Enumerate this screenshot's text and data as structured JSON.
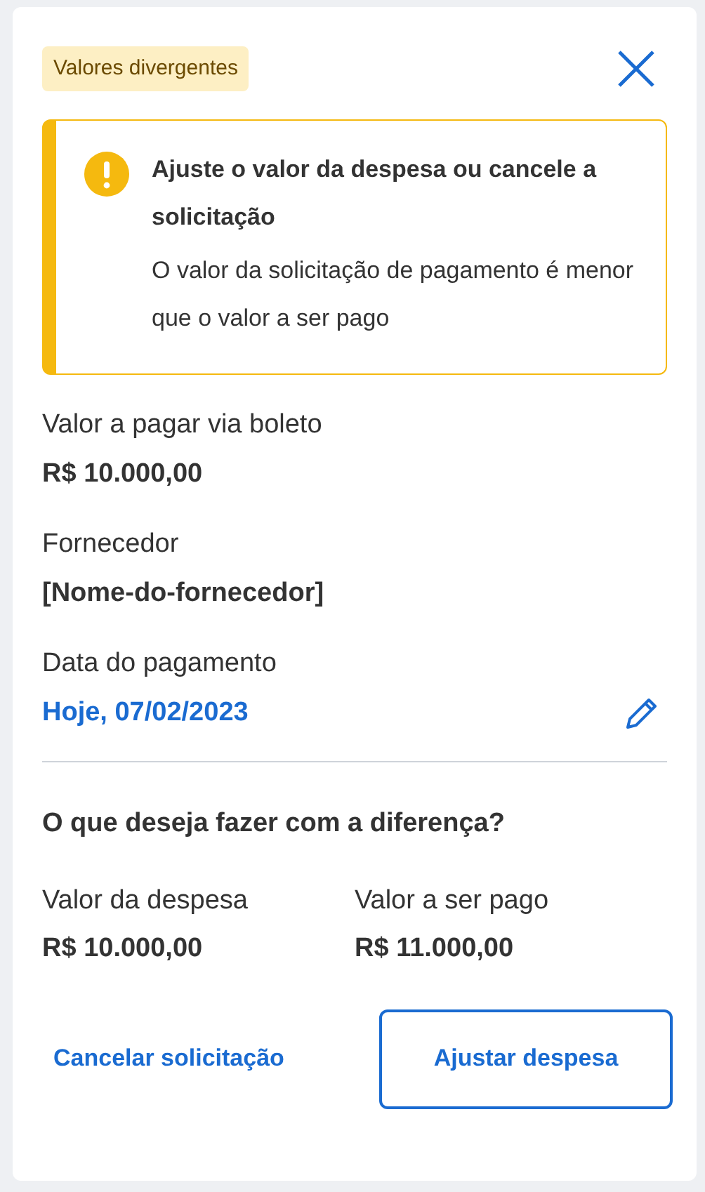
{
  "badge": "Valores divergentes",
  "alert": {
    "title": "Ajuste o valor da despesa ou cancele a solicitação",
    "message": "O valor da solicitação de pagamento é menor que o valor a ser pago"
  },
  "fields": [
    {
      "label": "Valor a pagar via boleto",
      "value": "R$ 10.000,00",
      "kind": "plain"
    },
    {
      "label": "Fornecedor",
      "value": "[Nome-do-fornecedor]",
      "kind": "plain"
    },
    {
      "label": "Data do pagamento",
      "value": "Hoje, 07/02/2023",
      "kind": "editable"
    }
  ],
  "question": "O que deseja fazer com a diferença?",
  "comparison": [
    {
      "label": "Valor da despesa",
      "value": "R$ 10.000,00"
    },
    {
      "label": "Valor a ser pago",
      "value": "R$ 11.000,00"
    }
  ],
  "actions": [
    {
      "label": "Cancelar solicitação",
      "kind": "link"
    },
    {
      "label": "Ajustar despesa",
      "kind": "outline"
    }
  ]
}
